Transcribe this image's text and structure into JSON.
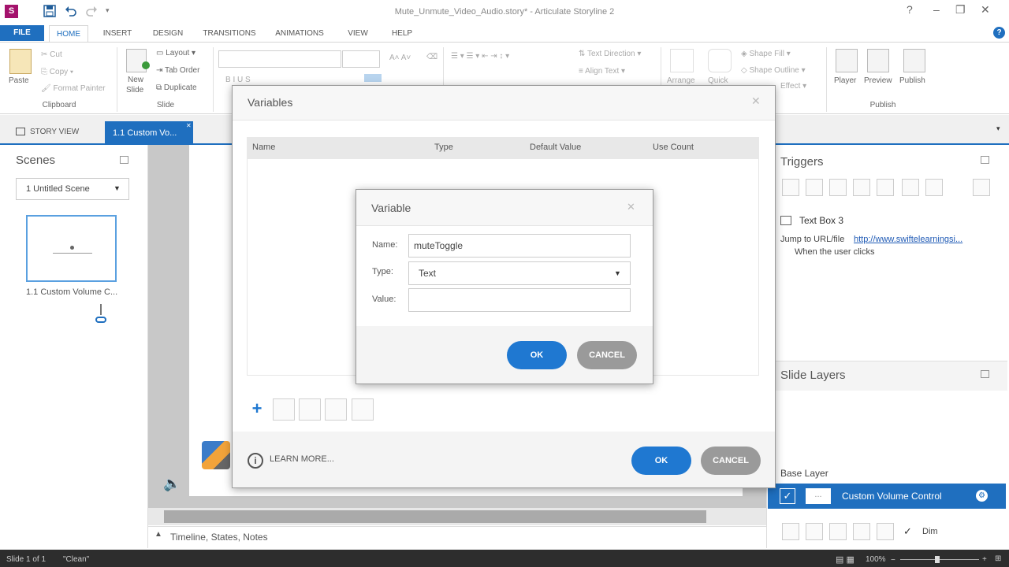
{
  "titlebar": {
    "title": "Mute_Unmute_Video_Audio.story* - Articulate Storyline 2",
    "app_icon": "S",
    "controls": [
      "?",
      "–",
      "❐",
      "✕"
    ]
  },
  "menu": {
    "file": "FILE",
    "tabs": [
      "HOME",
      "INSERT",
      "DESIGN",
      "TRANSITIONS",
      "ANIMATIONS",
      "VIEW",
      "HELP"
    ]
  },
  "ribbon": {
    "clipboard": {
      "paste": "Paste",
      "cut": "Cut",
      "copy": "Copy",
      "format_painter": "Format Painter",
      "label": "Clipboard"
    },
    "slide": {
      "new_slide_1": "New",
      "new_slide_2": "Slide",
      "layout": "Layout",
      "tab_order": "Tab Order",
      "duplicate": "Duplicate",
      "label": "Slide"
    },
    "text": {
      "text_direction": "Text Direction",
      "align_text": "Align Text"
    },
    "drawing": {
      "arrange": "Arrange",
      "quick": "Quick",
      "shape_fill": "Shape Fill",
      "shape_outline": "Shape Outline",
      "effect": "Effect"
    },
    "publish": {
      "player": "Player",
      "preview": "Preview",
      "publish": "Publish",
      "label": "Publish"
    }
  },
  "views": {
    "story_view": "STORY VIEW",
    "slide_tab": "1.1 Custom Vo..."
  },
  "scenes": {
    "title": "Scenes",
    "dropdown": "1 Untitled Scene",
    "slide_label": "1.1 Custom Volume C..."
  },
  "timeline": {
    "label": "Timeline, States, Notes"
  },
  "triggers": {
    "title": "Triggers",
    "item_name": "Text Box 3",
    "action": "Jump to URL/file",
    "url": "http://www.swiftelearningsi...",
    "condition": "When the user clicks"
  },
  "layers": {
    "title": "Slide Layers",
    "base_layer": "Base Layer",
    "layer_name": "Custom Volume Control",
    "dim": "Dim"
  },
  "status": {
    "slide": "Slide 1 of 1",
    "theme": "\"Clean\"",
    "zoom": "100%"
  },
  "variables_dialog": {
    "title": "Variables",
    "columns": [
      "Name",
      "Type",
      "Default Value",
      "Use Count"
    ],
    "learn_more": "LEARN MORE...",
    "ok": "OK",
    "cancel": "CANCEL"
  },
  "variable_dialog": {
    "title": "Variable",
    "name_label": "Name:",
    "name_value": "muteToggle",
    "type_label": "Type:",
    "type_value": "Text",
    "value_label": "Value:",
    "value_value": "",
    "ok": "OK",
    "cancel": "CANCEL"
  },
  "colors": {
    "accent": "#1f6fbf",
    "ok_button": "#1f78d1",
    "cancel_button": "#9a9a9a",
    "status_bar": "#2d2d2d"
  }
}
